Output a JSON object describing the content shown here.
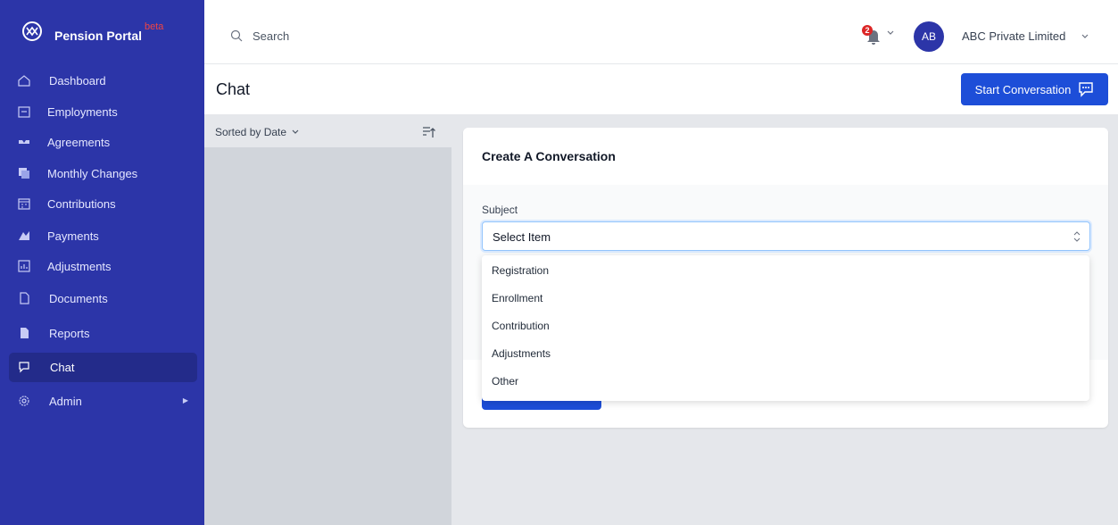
{
  "brand": {
    "title": "Pension Portal",
    "badge": "beta"
  },
  "sidebar": {
    "items": [
      {
        "label": "Dashboard",
        "icon": "home-icon"
      },
      {
        "label": "Employments",
        "icon": "briefcase-icon"
      },
      {
        "label": "Agreements",
        "icon": "handshake-icon"
      },
      {
        "label": "Monthly Changes",
        "icon": "copy-icon"
      },
      {
        "label": "Contributions",
        "icon": "calendar-icon"
      },
      {
        "label": "Payments",
        "icon": "payment-icon"
      },
      {
        "label": "Adjustments",
        "icon": "chart-icon"
      },
      {
        "label": "Documents",
        "icon": "document-icon"
      },
      {
        "label": "Reports",
        "icon": "report-icon"
      },
      {
        "label": "Chat",
        "icon": "chat-icon",
        "active": true
      },
      {
        "label": "Admin",
        "icon": "gear-icon",
        "has_submenu": true
      }
    ]
  },
  "topbar": {
    "search_placeholder": "Search",
    "notifications_count": "2",
    "avatar_initials": "AB",
    "company": "ABC Private Limited"
  },
  "header": {
    "title": "Chat",
    "start_button": "Start Conversation"
  },
  "chatlist": {
    "sort_label": "Sorted by Date"
  },
  "form": {
    "title": "Create A Conversation",
    "subject_label": "Subject",
    "subject_value": "Select Item",
    "options": [
      "Registration",
      "Enrollment",
      "Contribution",
      "Adjustments",
      "Other"
    ]
  },
  "colors": {
    "sidebar": "#2c35a8",
    "primary": "#1d4ed8",
    "badge": "#dc2626"
  }
}
